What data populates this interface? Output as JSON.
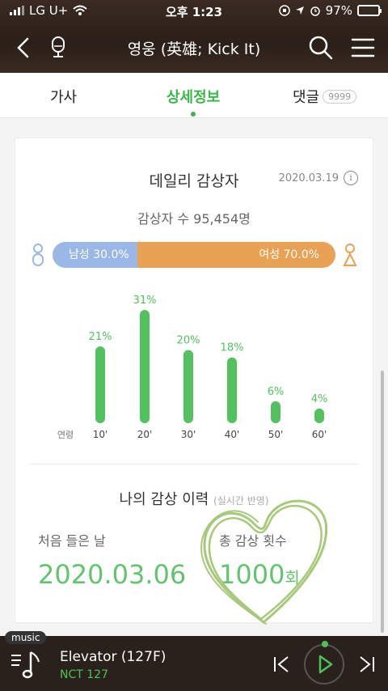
{
  "status": {
    "carrier": "LG U+",
    "time": "오후 1:23",
    "battery": "97%"
  },
  "header": {
    "title": "영웅 (英雄; Kick It)"
  },
  "tabs": [
    {
      "label": "가사"
    },
    {
      "label": "상세정보"
    },
    {
      "label": "댓글",
      "badge": "9999"
    }
  ],
  "daily": {
    "title": "데일리 감상자",
    "date": "2020.03.19",
    "info": "i",
    "listeners": "감상자 수 95,454명",
    "male_label": "남성 30.0%",
    "female_label": "여성 70.0%",
    "male_fraction": 0.3
  },
  "chart_data": {
    "type": "bar",
    "categories": [
      "10'",
      "20'",
      "30'",
      "40'",
      "50'",
      "60'"
    ],
    "values": [
      21,
      31,
      20,
      18,
      6,
      4
    ],
    "value_labels": [
      "21%",
      "31%",
      "20%",
      "18%",
      "6%",
      "4%"
    ],
    "xlabel": "연령",
    "color": "#54c15f"
  },
  "history": {
    "title": "나의 감상 이력",
    "subtitle": "(실시간 반영)",
    "first_label": "처음 들은 날",
    "first_value": "2020.03.06",
    "total_label": "총 감상 횟수",
    "total_value": "1000",
    "total_unit": "회"
  },
  "player": {
    "tag": "music",
    "song": "Elevator (127F)",
    "artist": "NCT 127"
  },
  "colors": {
    "accent": "#3cb54a",
    "male": "#9ab8e6",
    "female": "#e9a154"
  }
}
